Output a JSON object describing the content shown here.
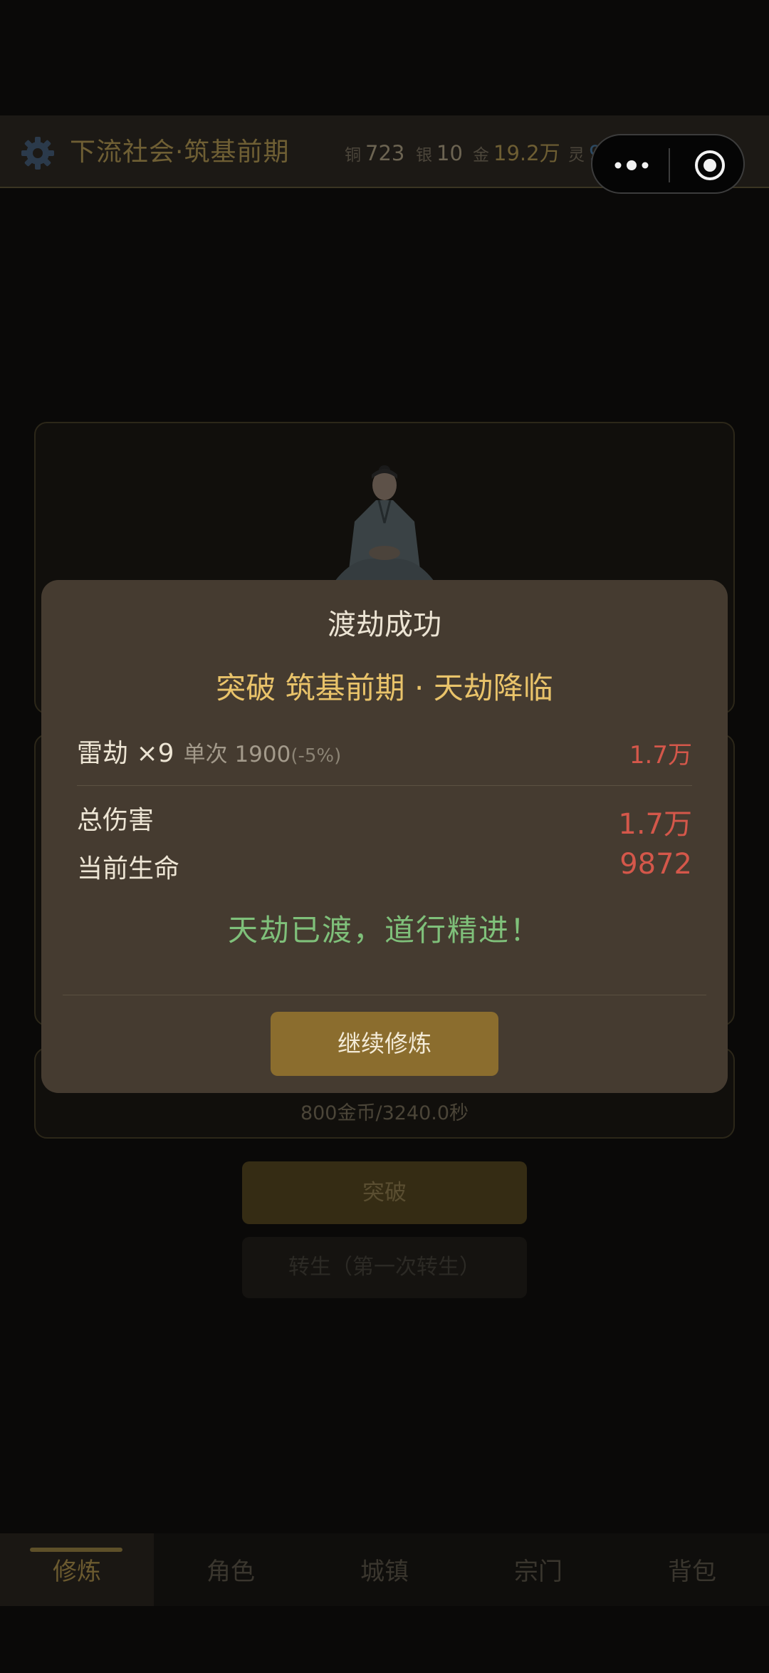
{
  "header": {
    "title": "下流社会·筑基前期",
    "resources": [
      {
        "label": "铜",
        "value": "723"
      },
      {
        "label": "银",
        "value": "10"
      },
      {
        "label": "金",
        "value": "19.2万"
      },
      {
        "label": "灵",
        "value": "979"
      }
    ]
  },
  "main": {
    "cost_text": "800金币/3240.0秒",
    "breakthrough_label": "突破",
    "rebirth_label": "转生（第一次转生）"
  },
  "modal": {
    "title": "渡劫成功",
    "subtitle": "突破 筑基前期 · 天劫降临",
    "thunder": {
      "label": "雷劫 ×9",
      "single_label": "单次 1900",
      "reduction": "(-5%)",
      "value": "1.7万"
    },
    "total_damage": {
      "label": "总伤害",
      "value": "1.7万"
    },
    "current_hp": {
      "label": "当前生命",
      "value": "9872"
    },
    "success_text": "天劫已渡，道行精进！",
    "button_label": "继续修炼"
  },
  "nav": {
    "tabs": [
      {
        "label": "修炼",
        "active": true
      },
      {
        "label": "角色"
      },
      {
        "label": "城镇"
      },
      {
        "label": "宗门"
      },
      {
        "label": "背包"
      }
    ]
  },
  "colors": {
    "modal_bg": "#453b30",
    "accent_gold": "#e9c36a",
    "damage_red": "#d4574a",
    "success_green": "#7fc07a",
    "button_gold": "#8b6d2e"
  }
}
